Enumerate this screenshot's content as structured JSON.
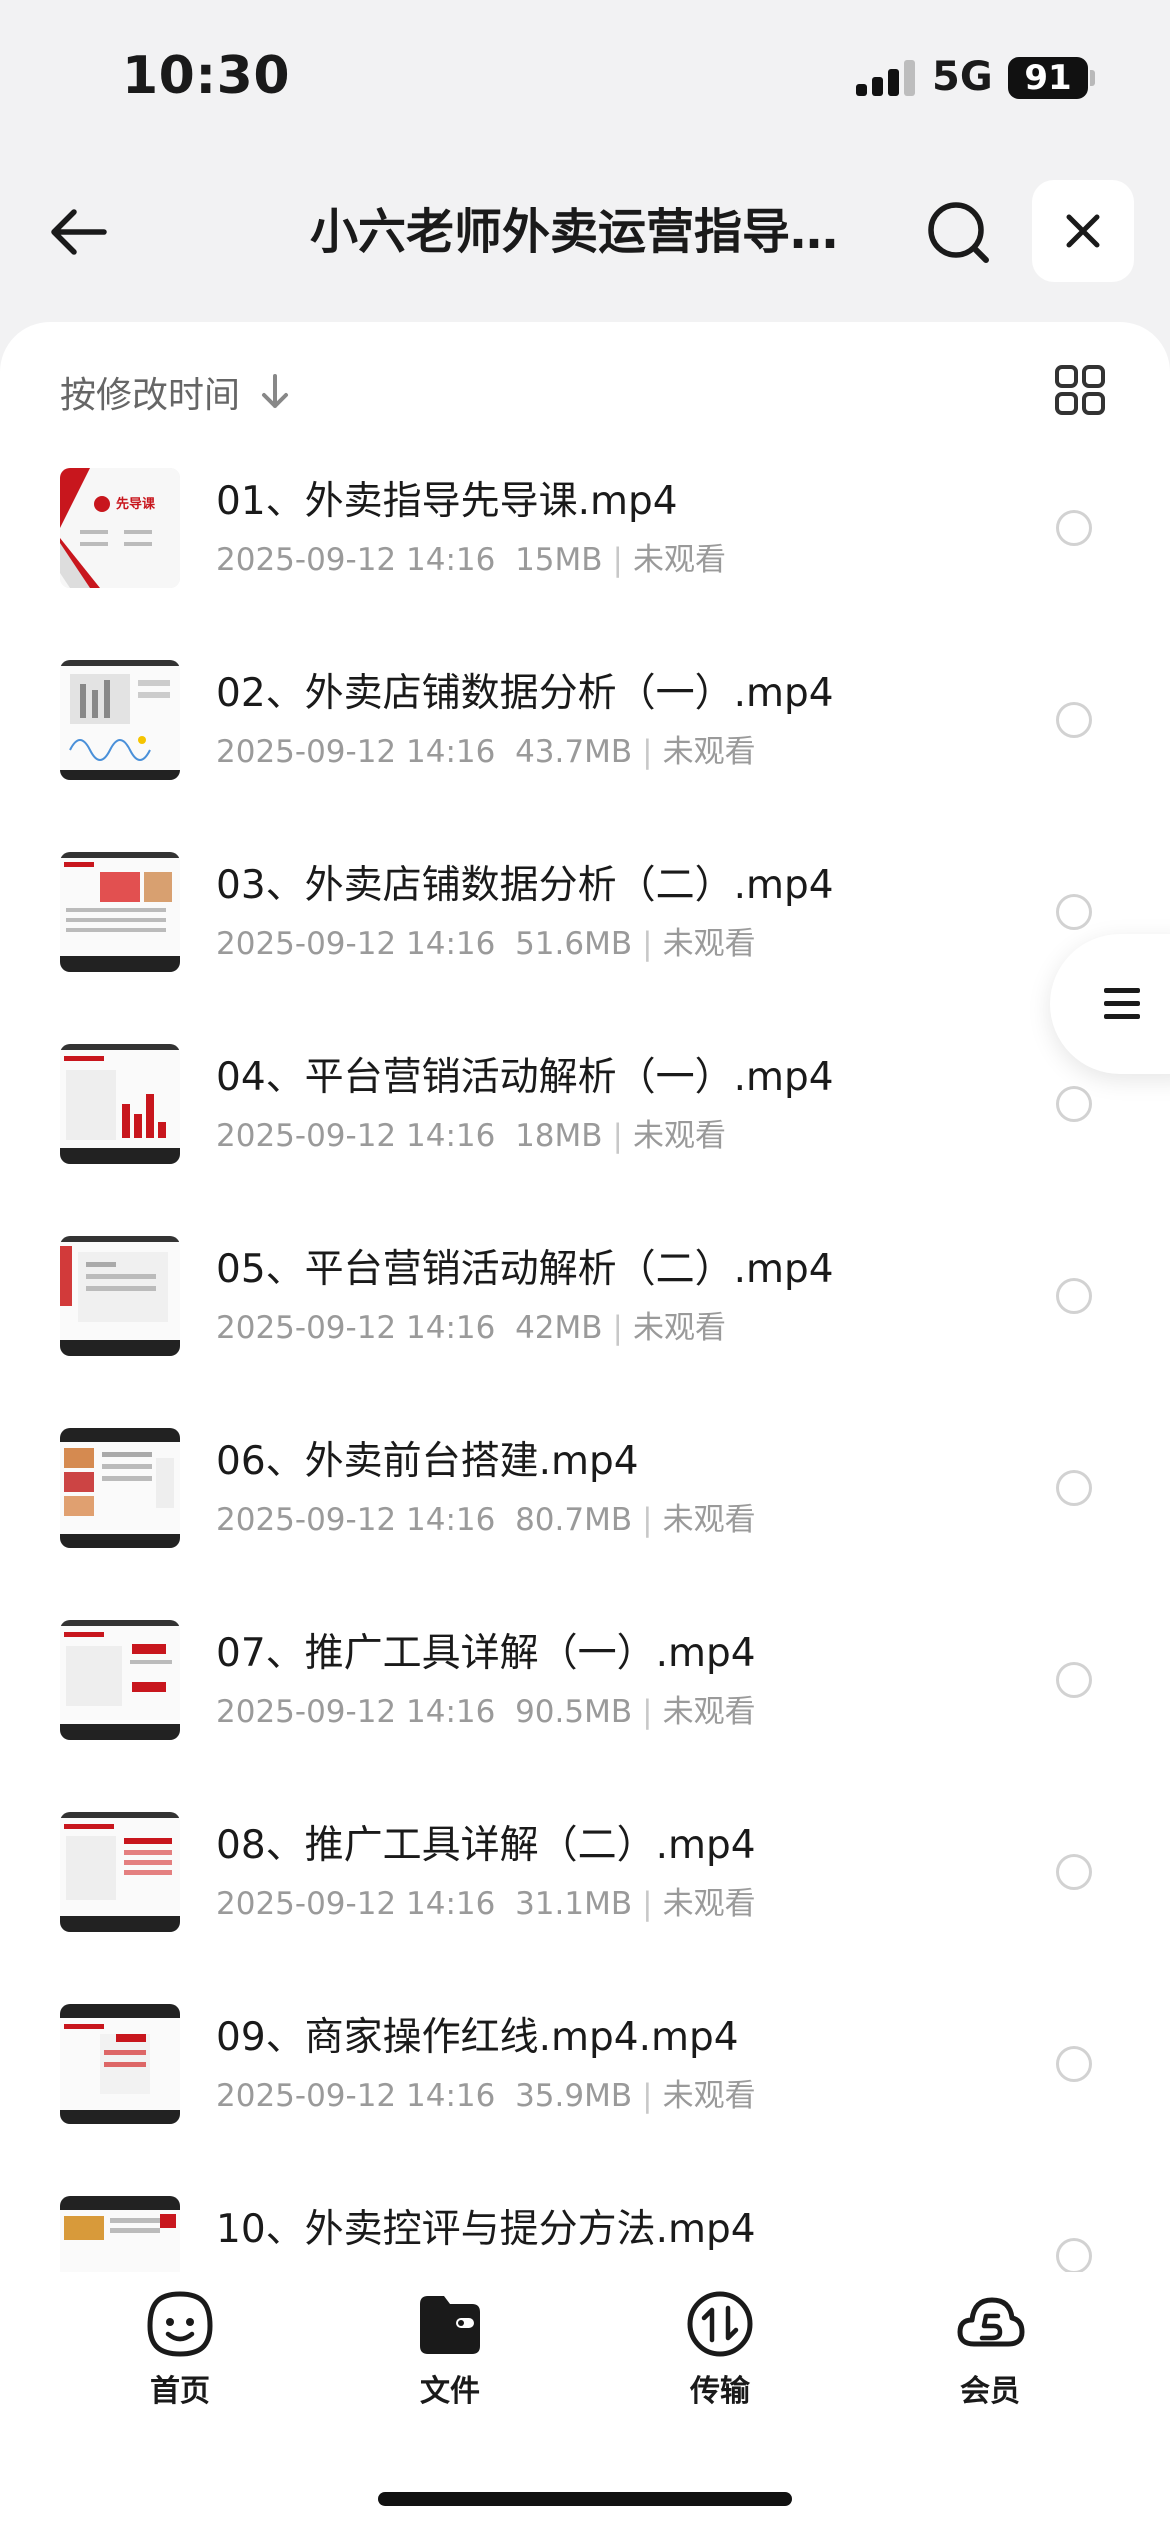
{
  "status_bar": {
    "time": "10:30",
    "network": "5G",
    "battery": "91"
  },
  "nav": {
    "title": "小六老师外卖运营指导…",
    "back_icon": "arrow-left-icon",
    "search_icon": "search-icon",
    "close_icon": "close-icon"
  },
  "sort": {
    "label": "按修改时间",
    "direction_icon": "arrow-down-icon",
    "view_icon": "grid-view-icon"
  },
  "files": [
    {
      "name": "01、外卖指导先导课.mp4",
      "date": "2025-09-12 14:16",
      "size": "15MB",
      "status": "未观看"
    },
    {
      "name": "02、外卖店铺数据分析（一）.mp4",
      "date": "2025-09-12 14:16",
      "size": "43.7MB",
      "status": "未观看"
    },
    {
      "name": "03、外卖店铺数据分析（二）.mp4",
      "date": "2025-09-12 14:16",
      "size": "51.6MB",
      "status": "未观看"
    },
    {
      "name": "04、平台营销活动解析（一）.mp4",
      "date": "2025-09-12 14:16",
      "size": "18MB",
      "status": "未观看"
    },
    {
      "name": "05、平台营销活动解析（二）.mp4",
      "date": "2025-09-12 14:16",
      "size": "42MB",
      "status": "未观看"
    },
    {
      "name": "06、外卖前台搭建.mp4",
      "date": "2025-09-12 14:16",
      "size": "80.7MB",
      "status": "未观看"
    },
    {
      "name": "07、推广工具详解（一）.mp4",
      "date": "2025-09-12 14:16",
      "size": "90.5MB",
      "status": "未观看"
    },
    {
      "name": "08、推广工具详解（二）.mp4",
      "date": "2025-09-12 14:16",
      "size": "31.1MB",
      "status": "未观看"
    },
    {
      "name": "09、商家操作红线.mp4.mp4",
      "date": "2025-09-12 14:16",
      "size": "35.9MB",
      "status": "未观看"
    },
    {
      "name": "10、外卖控评与提分方法.mp4",
      "date": "",
      "size": "",
      "status": ""
    }
  ],
  "thumb_texts": {
    "t1": "先导课"
  },
  "float_menu_icon": "menu-lines-icon",
  "tabbar": {
    "items": [
      {
        "label": "首页",
        "icon": "smiley-face-icon"
      },
      {
        "label": "文件",
        "icon": "folder-icon"
      },
      {
        "label": "传输",
        "icon": "transfer-icon"
      },
      {
        "label": "会员",
        "icon": "cloud-member-icon"
      }
    ]
  },
  "colors": {
    "accent_red": "#c8161d",
    "text_primary": "#1a1a1a",
    "text_secondary": "#9a9a9a",
    "background": "#f2f2f3"
  }
}
